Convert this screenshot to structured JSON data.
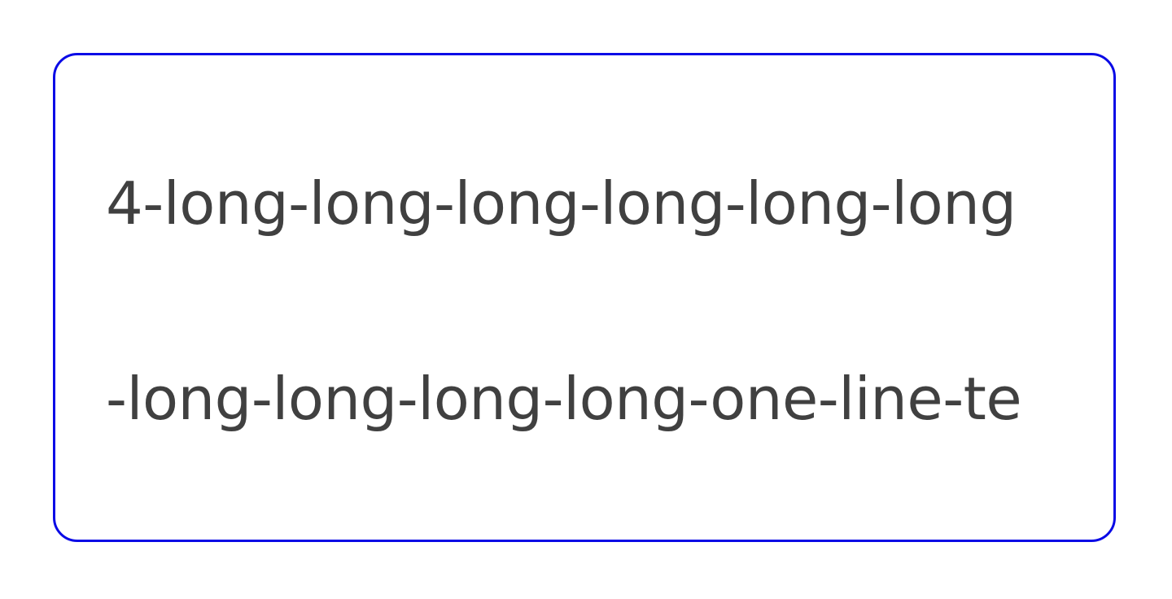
{
  "card": {
    "border_color": "#0a0ae6",
    "text_color": "#404040",
    "lines": [
      "4-long-long-long-long-long-long",
      "-long-long-long-long-one-line-te"
    ]
  }
}
